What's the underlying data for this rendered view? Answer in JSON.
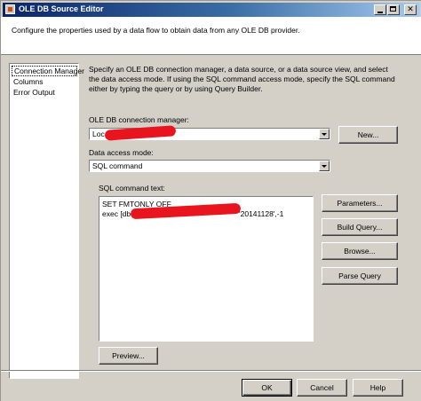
{
  "window": {
    "title": "OLE DB Source Editor"
  },
  "header": {
    "description": "Configure the properties used by a data flow to obtain data from any OLE DB provider."
  },
  "nav": {
    "items": [
      {
        "label": "Connection Manager",
        "selected": true
      },
      {
        "label": "Columns",
        "selected": false
      },
      {
        "label": "Error Output",
        "selected": false
      }
    ]
  },
  "main": {
    "description": "Specify an OLE DB connection manager, a data source, or a data source view, and select the data access mode. If using the SQL command access mode, specify the SQL command either by typing the query or by using Query Builder.",
    "connection_manager_label": "OLE DB connection manager:",
    "connection_manager_value": "Loca",
    "new_button": "New...",
    "data_access_mode_label": "Data access mode:",
    "data_access_mode_value": "SQL command",
    "sql_command_label": "SQL command text:",
    "sql_lines": [
      "SET FMTONLY OFF",
      "exec [dbo]",
      "'20141128',-1"
    ],
    "parameters_button": "Parameters...",
    "build_query_button": "Build Query...",
    "browse_button": "Browse...",
    "parse_query_button": "Parse Query",
    "preview_button": "Preview..."
  },
  "footer": {
    "ok_button": "OK",
    "cancel_button": "Cancel",
    "help_button": "Help"
  },
  "colors": {
    "redaction": "#e8141e",
    "titlebar_start": "#0a246a",
    "titlebar_end": "#a6caf0"
  }
}
